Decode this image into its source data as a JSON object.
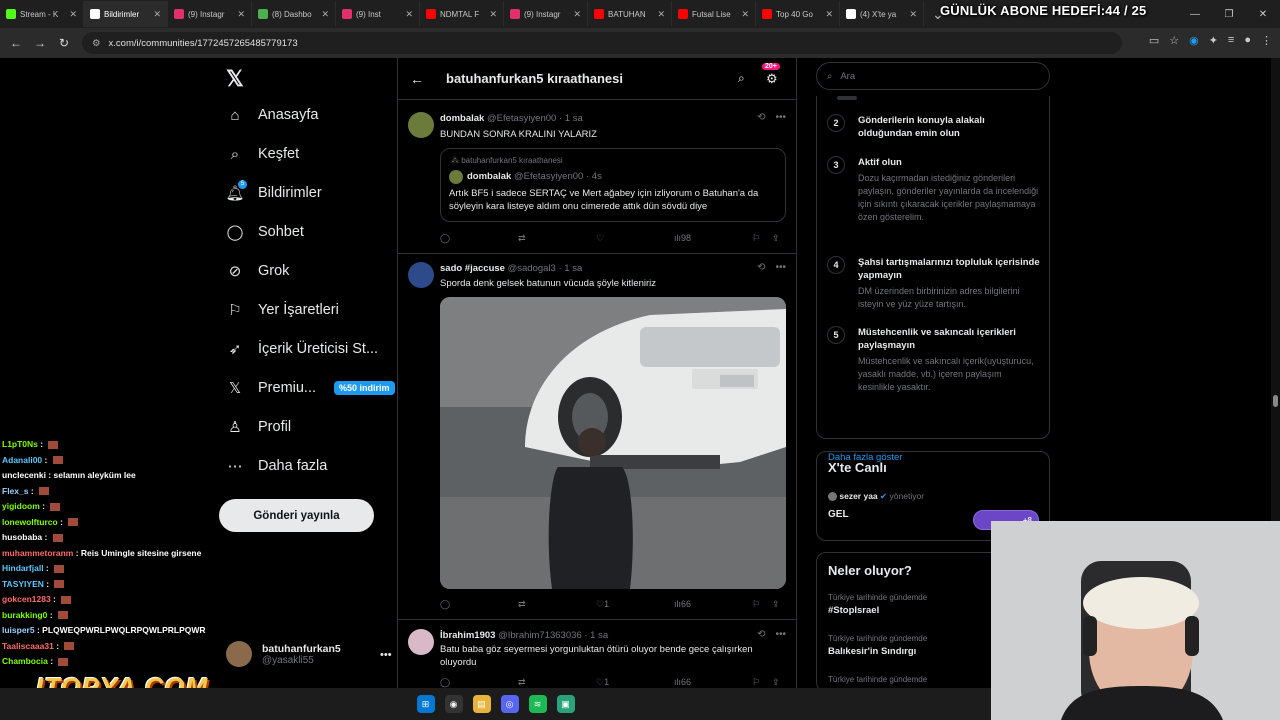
{
  "overlay": {
    "goal_text": "GÜNLÜK ABONE HEDEFİ:44 / 25",
    "brand": "ITOPYA.COM"
  },
  "browser": {
    "tabs": [
      {
        "title": "Stream - K",
        "color": "#53fc18",
        "icon": "kick-icon"
      },
      {
        "title": "Bildirimler",
        "color": "#ffffff",
        "icon": "x-icon"
      },
      {
        "title": "(9) Instagr",
        "color": "#e1306c",
        "icon": "instagram-icon"
      },
      {
        "title": "(8) Dashbo",
        "color": "#4caf50",
        "icon": "dashboard-icon"
      },
      {
        "title": "(9) Inst",
        "color": "#e1306c",
        "icon": "instagram-icon"
      },
      {
        "title": "NDMTAL F",
        "color": "#ff0000",
        "icon": "youtube-icon"
      },
      {
        "title": "(9) Instagr",
        "color": "#e1306c",
        "icon": "instagram-icon"
      },
      {
        "title": "BATUHAN",
        "color": "#ff0000",
        "icon": "youtube-icon"
      },
      {
        "title": "Futsal Lise",
        "color": "#ff0000",
        "icon": "youtube-icon"
      },
      {
        "title": "Top 40 Go",
        "color": "#ff0000",
        "icon": "youtube-icon"
      },
      {
        "title": "(4) X'te ya",
        "color": "#ffffff",
        "icon": "x-icon"
      }
    ],
    "url": "x.com/i/communities/1772457265485779173"
  },
  "sidebar": {
    "items": [
      {
        "label": "Anasayfa",
        "icon": "home-icon"
      },
      {
        "label": "Keşfet",
        "icon": "search-icon"
      },
      {
        "label": "Bildirimler",
        "icon": "bell-icon",
        "badge": "5"
      },
      {
        "label": "Sohbet",
        "icon": "chat-icon"
      },
      {
        "label": "Grok",
        "icon": "grok-icon"
      },
      {
        "label": "Yer İşaretleri",
        "icon": "bookmark-icon"
      },
      {
        "label": "İçerik Üreticisi St...",
        "icon": "rocket-icon"
      },
      {
        "label": "Premiu...",
        "icon": "x-logo-icon",
        "pill": "%50 indirim"
      },
      {
        "label": "Profil",
        "icon": "person-icon"
      },
      {
        "label": "Daha fazla",
        "icon": "more-circle-icon"
      }
    ],
    "post_button": "Gönderi yayınla",
    "account": {
      "name": "batuhanfurkan5",
      "handle": "@yasakli55"
    }
  },
  "community": {
    "title": "batuhanfurkan5 kıraathanesi",
    "badge": "20+",
    "tweets": [
      {
        "name": "dombalak",
        "handle": "@Efetasyiyen00",
        "time": "1 sa",
        "text": "BUNDAN SONRA KRALINI YALARIZ",
        "quote": {
          "community": "batuhanfurkan5 kıraathanesi",
          "name": "dombalak",
          "handle": "@Efetasyiyen00",
          "time": "4s",
          "text": "Artık BF5 i sadece SERTAÇ ve Mert ağabey için izliyorum o Batuhan'a da söyleyin kara listeye aldım onu cimerede attık dün sövdü diye"
        },
        "views": "98",
        "likes": ""
      },
      {
        "name": "sado #jaccuse",
        "handle": "@sadogal3",
        "time": "1 sa",
        "text": "Sporda denk gelsek batunun vücuda şöyle kitleniriz",
        "likes": "1",
        "views": "66"
      },
      {
        "name": "İbrahim1903",
        "handle": "@Ibrahim71363036",
        "time": "1 sa",
        "text": "Batu baba göz seyermesi yorgunluktan ötürü oluyor bende gece çalışırken oluyordu",
        "likes": "1",
        "views": "66"
      }
    ]
  },
  "right": {
    "search_placeholder": "Ara",
    "rules": [
      {
        "num": "2",
        "title": "Gönderilerin konuyla alakalı olduğundan emin olun",
        "desc": ""
      },
      {
        "num": "3",
        "title": "Aktif olun",
        "desc": "Dozu kaçırmadan istediğiniz gönderileri paylaşın, gönderiler yayınlarda da incelendiği için sıkıntı çıkaracak içerikler paylaşmamaya özen gösterelim."
      },
      {
        "num": "4",
        "title": "Şahsi tartışmalarınızı topluluk içerisinde yapmayın",
        "desc": "DM üzerinden birbirinizin adres bilgilerini isteyin ve yüz yüze tartışın."
      },
      {
        "num": "5",
        "title": "Müstehcenlik ve sakıncalı içerikleri paylaşmayın",
        "desc": "Müstehcenlik ve sakıncalı içerik(uyuşturucu, yasaklı madde, vb.) içeren paylaşım kesinlikle yasaktır."
      }
    ],
    "show_more": "Daha fazla göster",
    "live": {
      "title": "X'te Canlı",
      "host": "sezer yaa",
      "role": "yönetiyor",
      "text": "GEL",
      "extra": "+8"
    },
    "trends": {
      "title": "Neler oluyor?",
      "items": [
        {
          "context": "Türkiye tarihinde gündemde",
          "name": "#StopIsrael"
        },
        {
          "context": "Türkiye tarihinde gündemde",
          "name": "Balıkesir'in Sındırgı"
        },
        {
          "context": "Türkiye tarihinde gündemde",
          "name": ""
        }
      ]
    }
  },
  "chat": [
    {
      "user": "L1pT0Ns",
      "msg": "",
      "color": "#7fff00"
    },
    {
      "user": "Adanali00",
      "msg": "",
      "color": "#5cc8ff"
    },
    {
      "user": "unclecenki",
      "msg": "selamın aleyküm lee",
      "color": "#ffffff"
    },
    {
      "user": "Flex_s",
      "msg": "",
      "color": "#9ad0ff"
    },
    {
      "user": "yigidoom",
      "msg": "",
      "color": "#7fff00"
    },
    {
      "user": "lonewolfturco",
      "msg": "",
      "color": "#7fff00"
    },
    {
      "user": "husobaba",
      "msg": "",
      "color": "#ffffff"
    },
    {
      "user": "muhammetoranm",
      "msg": "Reis Umingle sitesine girsene",
      "color": "#ff6b6b"
    },
    {
      "user": "Hindarfjall",
      "msg": "",
      "color": "#5cc8ff"
    },
    {
      "user": "TASYIYEN",
      "msg": "",
      "color": "#5cc8ff"
    },
    {
      "user": "gokcen1283",
      "msg": "",
      "color": "#ff6b6b"
    },
    {
      "user": "burakking0",
      "msg": "",
      "color": "#7fff00"
    },
    {
      "user": "luisper5",
      "msg": "PLQWEQPWRLPWQLRPQWLPRLPQWR",
      "color": "#9ad0ff"
    },
    {
      "user": "Taaliscaaa31",
      "msg": "",
      "color": "#ff6b6b"
    },
    {
      "user": "Chambocia",
      "msg": "",
      "color": "#7fff00"
    }
  ]
}
